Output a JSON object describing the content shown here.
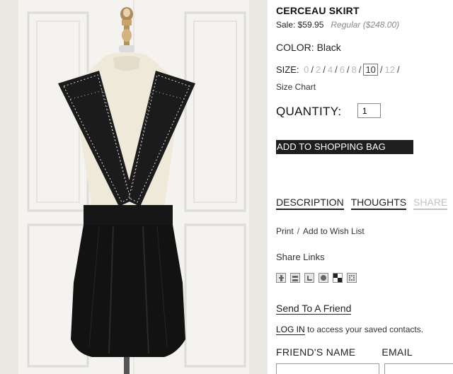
{
  "product": {
    "title": "CERCEAU SKIRT",
    "sale_price": "Sale: $59.95",
    "regular_price": "Regular ($248.00)",
    "color_label": "COLOR: Black"
  },
  "size": {
    "label": "SIZE:",
    "options": [
      "0",
      "2",
      "4",
      "6",
      "8",
      "10",
      "12"
    ],
    "selected": "10",
    "chart_link": "Size Chart"
  },
  "quantity": {
    "label": "QUANTITY:",
    "value": "1"
  },
  "add_to_bag": "ADD TO SHOPPING BAG",
  "tabs": [
    {
      "label": "DESCRIPTION",
      "active": true
    },
    {
      "label": "THOUGHTS",
      "active": true
    },
    {
      "label": "SHARE",
      "active": false
    }
  ],
  "actions": {
    "print": "Print",
    "separator": "/",
    "wishlist": "Add to Wish List"
  },
  "share": {
    "title": "Share Links",
    "icons": [
      "facebook-icon",
      "myspace-icon",
      "twitter-icon",
      "stumbleupon-icon",
      "delicious-icon",
      "digg-icon"
    ]
  },
  "send_friend": {
    "link": "Send To A Friend",
    "login_link": "LOG IN",
    "login_text": " to access your saved contacts.",
    "name_label": "FRIEND'S NAME",
    "email_label": "EMAIL"
  },
  "colors": {
    "button_bg": "#1e1e1e",
    "muted": "#b9b9b9",
    "regular_price": "#8a8a8a"
  }
}
